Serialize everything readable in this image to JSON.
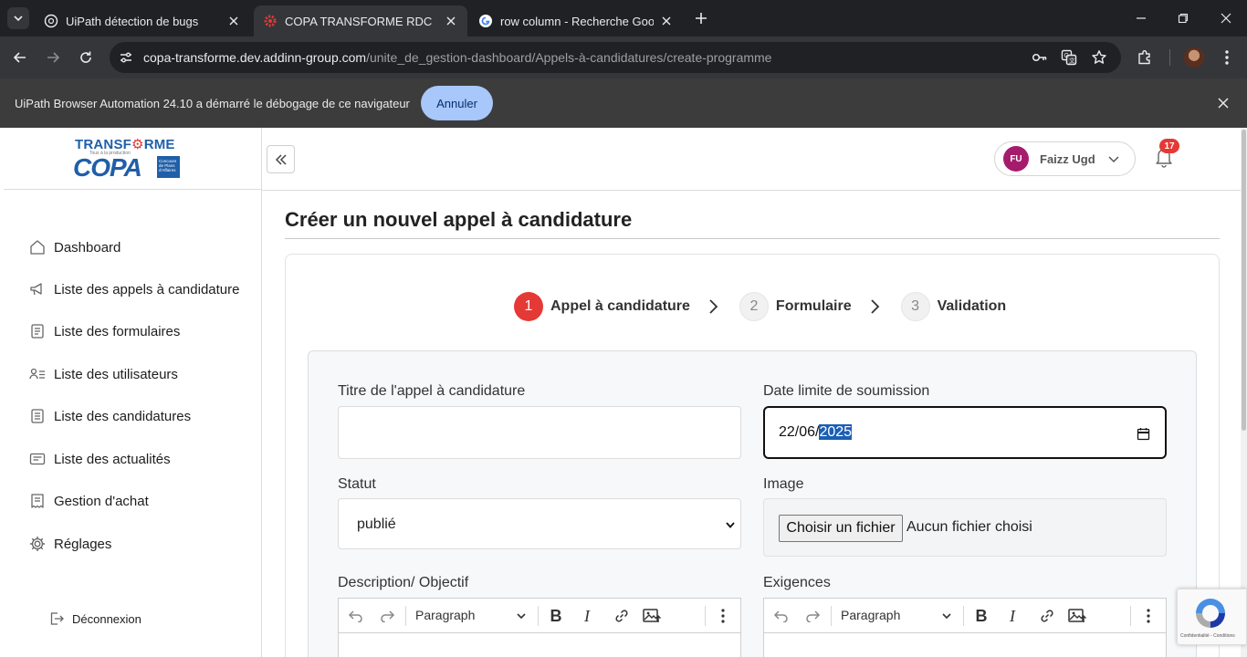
{
  "browser": {
    "tabs": [
      {
        "label": "UiPath détection de bugs",
        "active": false
      },
      {
        "label": "COPA TRANSFORME RDC",
        "active": true
      },
      {
        "label": "row column - Recherche Google",
        "active": false
      }
    ],
    "url_host": "copa-transforme.dev.addinn-group.com",
    "url_path": "/unite_de_gestion-dashboard/Appels-à-candidatures/create-programme",
    "infobar_message": "UiPath Browser Automation 24.10 a démarré le débogage de ce navigateur",
    "infobar_button": "Annuler"
  },
  "logo": {
    "top_text": "TRANSF",
    "top_text_end": "RME",
    "sub_text": "Tous à la production",
    "main_text": "COPA",
    "badge_text": "Concours de Plans d'Affaires"
  },
  "sidebar": {
    "items": [
      {
        "label": "Dashboard",
        "icon": "home-icon"
      },
      {
        "label": "Liste des appels à candidature",
        "icon": "megaphone-icon"
      },
      {
        "label": "Liste des formulaires",
        "icon": "form-icon"
      },
      {
        "label": "Liste des utilisateurs",
        "icon": "users-list-icon"
      },
      {
        "label": "Liste des candidatures",
        "icon": "document-icon"
      },
      {
        "label": "Liste des actualités",
        "icon": "news-icon"
      },
      {
        "label": "Gestion d'achat",
        "icon": "receipt-icon"
      },
      {
        "label": "Réglages",
        "icon": "gear-icon"
      }
    ],
    "logout_label": "Déconnexion"
  },
  "header": {
    "user_initials": "FU",
    "user_name": "Faizz Ugd",
    "notification_count": "17"
  },
  "main": {
    "title": "Créer un nouvel appel à candidature",
    "steps": [
      {
        "number": "1",
        "label": "Appel à candidature",
        "active": true
      },
      {
        "number": "2",
        "label": "Formulaire",
        "active": false
      },
      {
        "number": "3",
        "label": "Validation",
        "active": false
      }
    ],
    "form": {
      "title_label": "Titre de l'appel à candidature",
      "title_value": "",
      "deadline_label": "Date limite de soumission",
      "deadline_day_month": "22/06/",
      "deadline_year": "2025",
      "status_label": "Statut",
      "status_value": "publié",
      "image_label": "Image",
      "file_button": "Choisir un fichier",
      "file_status": "Aucun fichier choisi",
      "description_label": "Description/ Objectif",
      "requirements_label": "Exigences",
      "editor_paragraph": "Paragraph"
    }
  },
  "recaptcha": {
    "footer": "Confidentialité - Conditions"
  },
  "colors": {
    "accent_red": "#e53935",
    "brand_blue": "#1f5fa8",
    "avatar": "#a51c6c",
    "infobar_button": "#a8c7fa"
  }
}
